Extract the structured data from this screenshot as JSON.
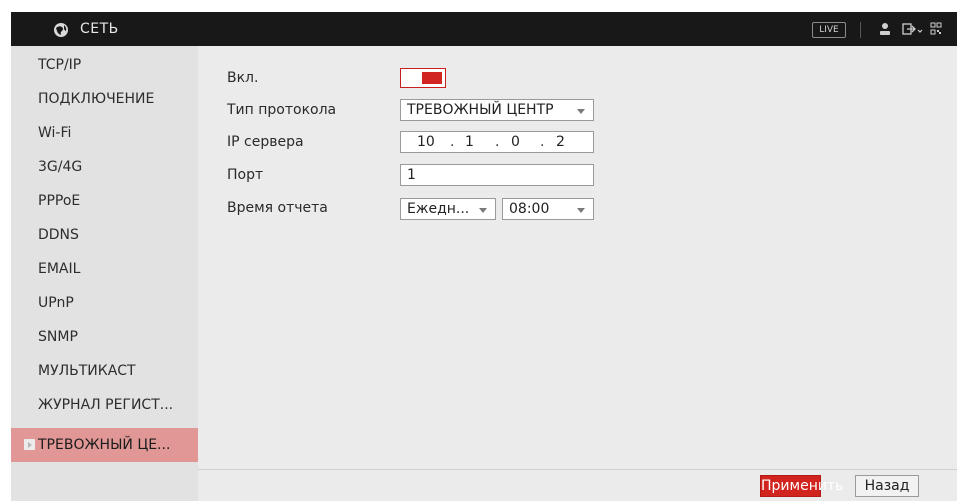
{
  "header": {
    "title": "СЕТЬ",
    "title_icon": "network-globe-icon",
    "live_label": "LIVE",
    "icons": [
      "user-icon",
      "logout-icon",
      "qr-code-icon"
    ]
  },
  "sidebar": {
    "items": [
      {
        "label": "TCP/IP"
      },
      {
        "label": "ПОДКЛЮЧЕНИЕ"
      },
      {
        "label": "Wi-Fi"
      },
      {
        "label": "3G/4G"
      },
      {
        "label": "PPPoE"
      },
      {
        "label": "DDNS"
      },
      {
        "label": "EMAIL"
      },
      {
        "label": "UPnP"
      },
      {
        "label": "SNMP"
      },
      {
        "label": "МУЛЬТИКАСТ"
      },
      {
        "label": "ЖУРНАЛ РЕГИСТ..."
      },
      {
        "label": "ТРЕВОЖНЫЙ ЦЕ...",
        "active": true
      }
    ]
  },
  "form": {
    "enable": {
      "label": "Вкл.",
      "on": true
    },
    "protocol": {
      "label": "Тип протокола",
      "value": "ТРЕВОЖНЫЙ ЦЕНТР"
    },
    "server_ip": {
      "label": "IP сервера",
      "octets": [
        "10",
        "1",
        "0",
        "2"
      ],
      "separator": "."
    },
    "port": {
      "label": "Порт",
      "value": "1"
    },
    "report_time": {
      "label": "Время отчета",
      "frequency": "Ежедн...",
      "time": "08:00"
    }
  },
  "actions": {
    "apply": "Применить",
    "back": "Назад"
  },
  "colors": {
    "accent": "#d2241e",
    "active_item": "#e09795",
    "header_bg": "#181818"
  }
}
